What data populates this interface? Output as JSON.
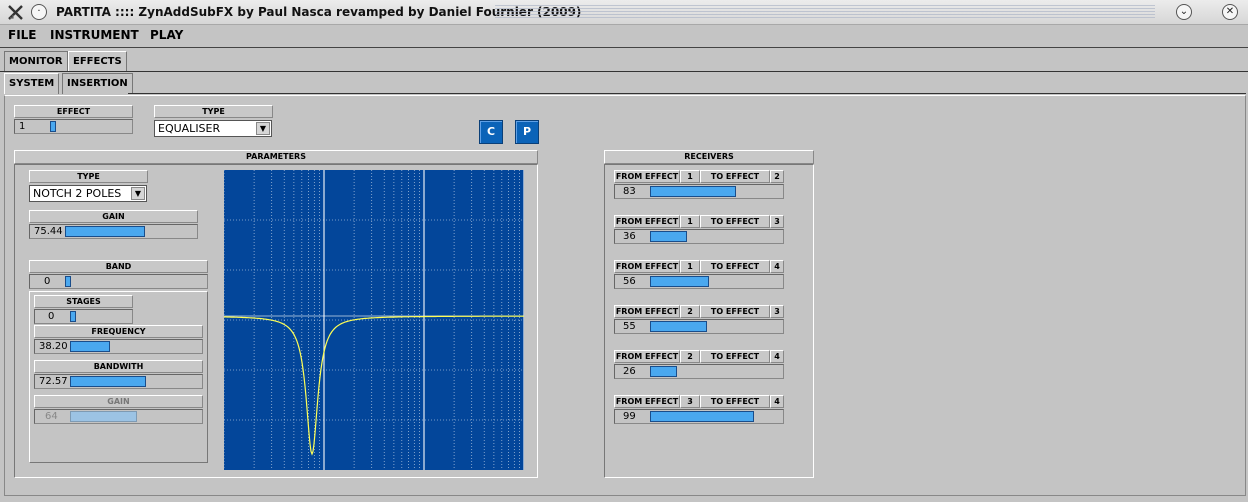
{
  "window": {
    "title": "PARTITA :::: ZynAddSubFX by Paul Nasca revamped by Daniel Fournier (2009)"
  },
  "menu": [
    "FILE",
    "INSTRUMENT",
    "PLAY"
  ],
  "tabs": {
    "main": [
      "MONITOR",
      "EFFECTS"
    ],
    "sub": [
      "SYSTEM",
      "INSERTION"
    ]
  },
  "effect": {
    "label": "EFFECT",
    "value": "1",
    "level": 0.0
  },
  "type": {
    "label": "TYPE",
    "value": "EQUALISER"
  },
  "buttons": {
    "c": "C",
    "p": "P"
  },
  "parameters": {
    "title": "PARAMETERS",
    "type_label": "TYPE",
    "type_value": "NOTCH 2 POLES",
    "gain_label": "GAIN",
    "gain_value": "75.44",
    "gain_level": 0.59,
    "band_label": "BAND",
    "band_value": "0",
    "band_level": 0.0,
    "stages_label": "STAGES",
    "stages_value": "0",
    "stages_level": 0.0,
    "frequency_label": "FREQUENCY",
    "frequency_value": "38.20",
    "frequency_level": 0.3,
    "bandwith_label": "BANDWITH",
    "bandwith_value": "72.57",
    "bandwith_level": 0.57,
    "gain2_label": "GAIN",
    "gain2_value": "64",
    "gain2_level": 0.5
  },
  "receivers": {
    "title": "RECEIVERS",
    "from_label": "FROM EFFECT",
    "to_label": "TO EFFECT",
    "rows": [
      {
        "from": "1",
        "to": "2",
        "value": "83",
        "level": 0.65
      },
      {
        "from": "1",
        "to": "3",
        "value": "36",
        "level": 0.28
      },
      {
        "from": "1",
        "to": "4",
        "value": "56",
        "level": 0.44
      },
      {
        "from": "2",
        "to": "3",
        "value": "55",
        "level": 0.43
      },
      {
        "from": "2",
        "to": "4",
        "value": "26",
        "level": 0.2
      },
      {
        "from": "3",
        "to": "4",
        "value": "99",
        "level": 0.78
      }
    ]
  },
  "colors": {
    "graph_bg": "#03469a",
    "curve": "#ffff55",
    "slider_fill": "#4aa8ef",
    "button_blue": "#0b63b8"
  }
}
